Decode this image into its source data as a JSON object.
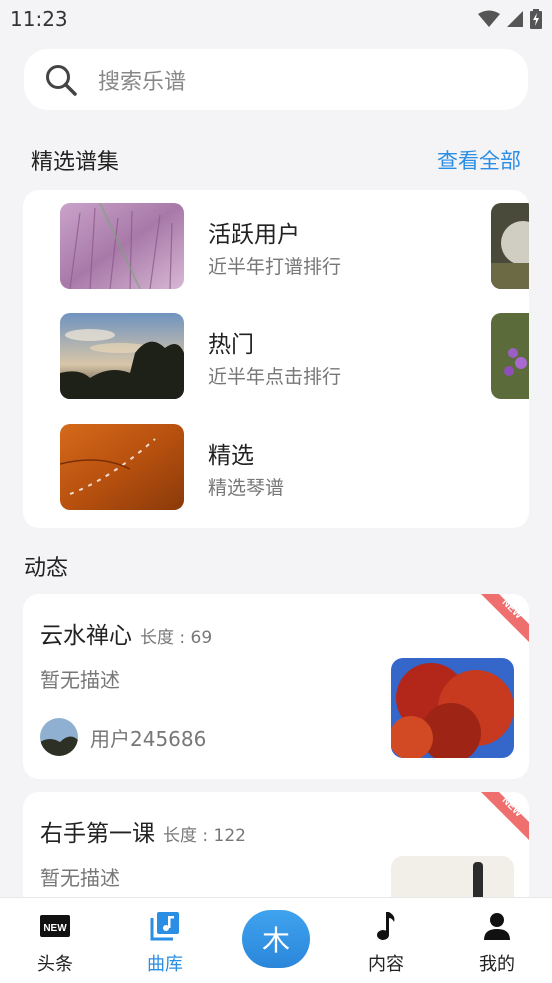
{
  "status_bar": {
    "time": "11:23",
    "icons": [
      "wifi-icon",
      "signal-icon",
      "battery-charging-icon"
    ]
  },
  "search": {
    "placeholder": "搜索乐谱",
    "icon": "search-icon"
  },
  "featured": {
    "title": "精选谱集",
    "view_all": "查看全部",
    "items": [
      {
        "title": "活跃用户",
        "subtitle": "近半年打谱排行"
      },
      {
        "title": "热门",
        "subtitle": "近半年点击排行"
      },
      {
        "title": "精选",
        "subtitle": "精选琴谱"
      }
    ]
  },
  "activity": {
    "title": "动态",
    "items": [
      {
        "title": "云水禅心",
        "length": "长度 : 69",
        "description": "暂无描述",
        "user": "用户245686",
        "badge": "NEW"
      },
      {
        "title": "右手第一课",
        "length": "长度 : 122",
        "description": "暂无描述",
        "badge": "NEW"
      }
    ]
  },
  "bottom_nav": {
    "items": [
      {
        "label": "头条",
        "icon": "new-icon"
      },
      {
        "label": "曲库",
        "icon": "music-library-icon",
        "active": true
      },
      {
        "label": "木",
        "icon": "center-action-icon"
      },
      {
        "label": "内容",
        "icon": "music-note-icon"
      },
      {
        "label": "我的",
        "icon": "person-icon"
      }
    ],
    "active_color": "#2a8ee4"
  }
}
